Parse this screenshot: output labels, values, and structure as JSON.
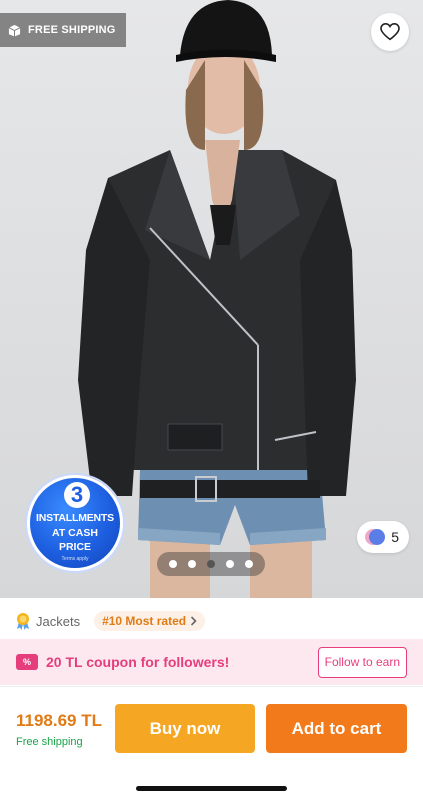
{
  "hero": {
    "free_shipping_label": "FREE SHIPPING",
    "installments": {
      "number": "3",
      "line1": "INSTALLMENTS",
      "line2": "AT CASH",
      "line3": "PRICE",
      "fine_print": "Terms apply"
    },
    "color_count": "5",
    "pager": {
      "total": 5,
      "active_index": 2
    },
    "icons": [
      "box-icon",
      "heart-icon"
    ]
  },
  "category": {
    "label": "Jackets",
    "rank": "#10 Most rated",
    "icons": [
      "medal-icon",
      "chevron-right-icon"
    ]
  },
  "coupon": {
    "icon_text": "%",
    "text": "20 TL coupon for followers!",
    "follow_label": "Follow to earn"
  },
  "purchase": {
    "price": "1198.69 TL",
    "shipping_note": "Free shipping",
    "buy_now_label": "Buy now",
    "add_to_cart_label": "Add to cart"
  },
  "colors": {
    "orange": "#f27a1a",
    "amber": "#f5a623",
    "pink": "#e63e7c",
    "green": "#1aa34a",
    "blue": "#1d5fe0"
  }
}
